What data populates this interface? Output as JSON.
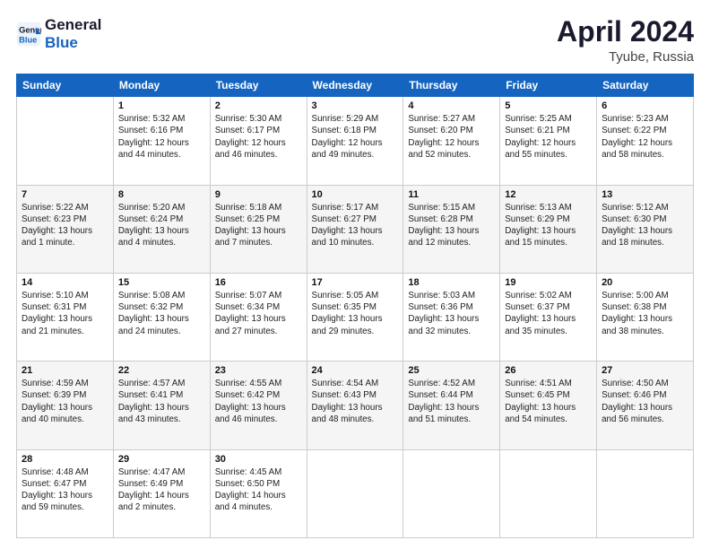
{
  "header": {
    "logo_line1": "General",
    "logo_line2": "Blue",
    "title": "April 2024",
    "subtitle": "Tyube, Russia"
  },
  "weekdays": [
    "Sunday",
    "Monday",
    "Tuesday",
    "Wednesday",
    "Thursday",
    "Friday",
    "Saturday"
  ],
  "weeks": [
    [
      null,
      {
        "day": "1",
        "sunrise": "5:32 AM",
        "sunset": "6:16 PM",
        "daylight": "12 hours and 44 minutes."
      },
      {
        "day": "2",
        "sunrise": "5:30 AM",
        "sunset": "6:17 PM",
        "daylight": "12 hours and 46 minutes."
      },
      {
        "day": "3",
        "sunrise": "5:29 AM",
        "sunset": "6:18 PM",
        "daylight": "12 hours and 49 minutes."
      },
      {
        "day": "4",
        "sunrise": "5:27 AM",
        "sunset": "6:20 PM",
        "daylight": "12 hours and 52 minutes."
      },
      {
        "day": "5",
        "sunrise": "5:25 AM",
        "sunset": "6:21 PM",
        "daylight": "12 hours and 55 minutes."
      },
      {
        "day": "6",
        "sunrise": "5:23 AM",
        "sunset": "6:22 PM",
        "daylight": "12 hours and 58 minutes."
      }
    ],
    [
      {
        "day": "7",
        "sunrise": "5:22 AM",
        "sunset": "6:23 PM",
        "daylight": "13 hours and 1 minute."
      },
      {
        "day": "8",
        "sunrise": "5:20 AM",
        "sunset": "6:24 PM",
        "daylight": "13 hours and 4 minutes."
      },
      {
        "day": "9",
        "sunrise": "5:18 AM",
        "sunset": "6:25 PM",
        "daylight": "13 hours and 7 minutes."
      },
      {
        "day": "10",
        "sunrise": "5:17 AM",
        "sunset": "6:27 PM",
        "daylight": "13 hours and 10 minutes."
      },
      {
        "day": "11",
        "sunrise": "5:15 AM",
        "sunset": "6:28 PM",
        "daylight": "13 hours and 12 minutes."
      },
      {
        "day": "12",
        "sunrise": "5:13 AM",
        "sunset": "6:29 PM",
        "daylight": "13 hours and 15 minutes."
      },
      {
        "day": "13",
        "sunrise": "5:12 AM",
        "sunset": "6:30 PM",
        "daylight": "13 hours and 18 minutes."
      }
    ],
    [
      {
        "day": "14",
        "sunrise": "5:10 AM",
        "sunset": "6:31 PM",
        "daylight": "13 hours and 21 minutes."
      },
      {
        "day": "15",
        "sunrise": "5:08 AM",
        "sunset": "6:32 PM",
        "daylight": "13 hours and 24 minutes."
      },
      {
        "day": "16",
        "sunrise": "5:07 AM",
        "sunset": "6:34 PM",
        "daylight": "13 hours and 27 minutes."
      },
      {
        "day": "17",
        "sunrise": "5:05 AM",
        "sunset": "6:35 PM",
        "daylight": "13 hours and 29 minutes."
      },
      {
        "day": "18",
        "sunrise": "5:03 AM",
        "sunset": "6:36 PM",
        "daylight": "13 hours and 32 minutes."
      },
      {
        "day": "19",
        "sunrise": "5:02 AM",
        "sunset": "6:37 PM",
        "daylight": "13 hours and 35 minutes."
      },
      {
        "day": "20",
        "sunrise": "5:00 AM",
        "sunset": "6:38 PM",
        "daylight": "13 hours and 38 minutes."
      }
    ],
    [
      {
        "day": "21",
        "sunrise": "4:59 AM",
        "sunset": "6:39 PM",
        "daylight": "13 hours and 40 minutes."
      },
      {
        "day": "22",
        "sunrise": "4:57 AM",
        "sunset": "6:41 PM",
        "daylight": "13 hours and 43 minutes."
      },
      {
        "day": "23",
        "sunrise": "4:55 AM",
        "sunset": "6:42 PM",
        "daylight": "13 hours and 46 minutes."
      },
      {
        "day": "24",
        "sunrise": "4:54 AM",
        "sunset": "6:43 PM",
        "daylight": "13 hours and 48 minutes."
      },
      {
        "day": "25",
        "sunrise": "4:52 AM",
        "sunset": "6:44 PM",
        "daylight": "13 hours and 51 minutes."
      },
      {
        "day": "26",
        "sunrise": "4:51 AM",
        "sunset": "6:45 PM",
        "daylight": "13 hours and 54 minutes."
      },
      {
        "day": "27",
        "sunrise": "4:50 AM",
        "sunset": "6:46 PM",
        "daylight": "13 hours and 56 minutes."
      }
    ],
    [
      {
        "day": "28",
        "sunrise": "4:48 AM",
        "sunset": "6:47 PM",
        "daylight": "13 hours and 59 minutes."
      },
      {
        "day": "29",
        "sunrise": "4:47 AM",
        "sunset": "6:49 PM",
        "daylight": "14 hours and 2 minutes."
      },
      {
        "day": "30",
        "sunrise": "4:45 AM",
        "sunset": "6:50 PM",
        "daylight": "14 hours and 4 minutes."
      },
      null,
      null,
      null,
      null
    ]
  ],
  "labels": {
    "sunrise": "Sunrise:",
    "sunset": "Sunset:",
    "daylight": "Daylight:"
  }
}
